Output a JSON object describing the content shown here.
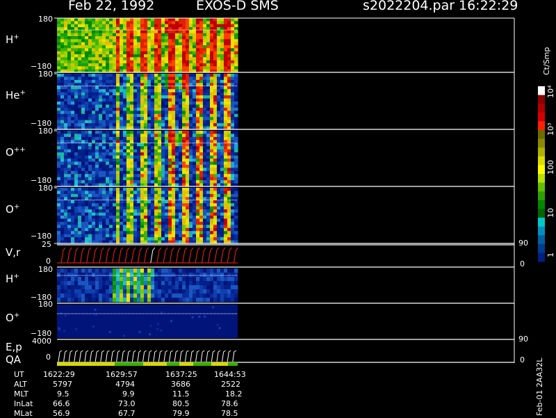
{
  "header": {
    "date": "Feb 22, 1992",
    "instrument": "EXOS-D SMS",
    "file": "s2022204.par",
    "time": "16:22:29"
  },
  "panels": [
    {
      "label_base": "H",
      "label_sup": "+",
      "top_tick": "180",
      "bottom_tick": "−180"
    },
    {
      "label_base": "He",
      "label_sup": "+",
      "top_tick": "180",
      "bottom_tick": "−180"
    },
    {
      "label_base": "O",
      "label_sup": "++",
      "top_tick": "180",
      "bottom_tick": "−180"
    },
    {
      "label_base": "O",
      "label_sup": "+",
      "top_tick": "180",
      "bottom_tick": "−180"
    }
  ],
  "vr_panel": {
    "label": "V,r",
    "top_tick": "25",
    "bottom_tick": "0",
    "right_top": "90",
    "right_bottom": "0"
  },
  "low_panels": [
    {
      "label_base": "H",
      "label_sup": "+",
      "top_tick": "180",
      "bottom_tick": "−180"
    },
    {
      "label_base": "O",
      "label_sup": "+",
      "top_tick": "180",
      "bottom_tick": "−180"
    }
  ],
  "ep_panel": {
    "label_top": "E,p",
    "label_bottom": "QA",
    "top_tick": "4000",
    "bottom_tick": "0",
    "right_top": "90",
    "right_bottom": "0"
  },
  "colorbar": {
    "unit": "Ct/Smp",
    "ticks": [
      "10⁴",
      "10³",
      "100",
      "10",
      "1"
    ],
    "colors": [
      "#ffffff",
      "#8b0000",
      "#b00000",
      "#d40000",
      "#ff2000",
      "#6b6b00",
      "#8b8b00",
      "#b0b000",
      "#dcdc00",
      "#ffff00",
      "#b8e000",
      "#60c000",
      "#30a000",
      "#008800",
      "#006600",
      "#00c8c8",
      "#0090c0",
      "#0060a0",
      "#003c90",
      "#002080"
    ]
  },
  "ephemeris": {
    "rows": [
      {
        "name": "UT",
        "values": [
          "1622:29",
          "1629:57",
          "1637:25",
          "1644:53"
        ]
      },
      {
        "name": "ALT",
        "values": [
          "5797",
          "4794",
          "3686",
          "2522"
        ]
      },
      {
        "name": "MLT",
        "values": [
          "9.5",
          "9.9",
          "11.5",
          "18.2"
        ]
      },
      {
        "name": "InLat",
        "values": [
          "66.6",
          "73.0",
          "80.5",
          "78.6"
        ]
      },
      {
        "name": "MLat",
        "values": [
          "56.9",
          "67.7",
          "79.9",
          "78.5"
        ]
      }
    ]
  },
  "footer_vertical": "Feb-01 2AA32L",
  "chart_data": {
    "type": "heatmap",
    "title": "Feb 22, 1992   EXOS-D SMS",
    "panels": [
      "H+",
      "He+",
      "O++",
      "O+",
      "V,r",
      "H+",
      "O+",
      "E,p",
      "QA"
    ],
    "xlabel": "UT",
    "x_ticks": [
      "1622:29",
      "1629:57",
      "1637:25",
      "1644:53"
    ],
    "colorbar_label": "Ct/Smp",
    "colorbar_scale": "log",
    "colorbar_range": [
      1,
      10000
    ]
  }
}
